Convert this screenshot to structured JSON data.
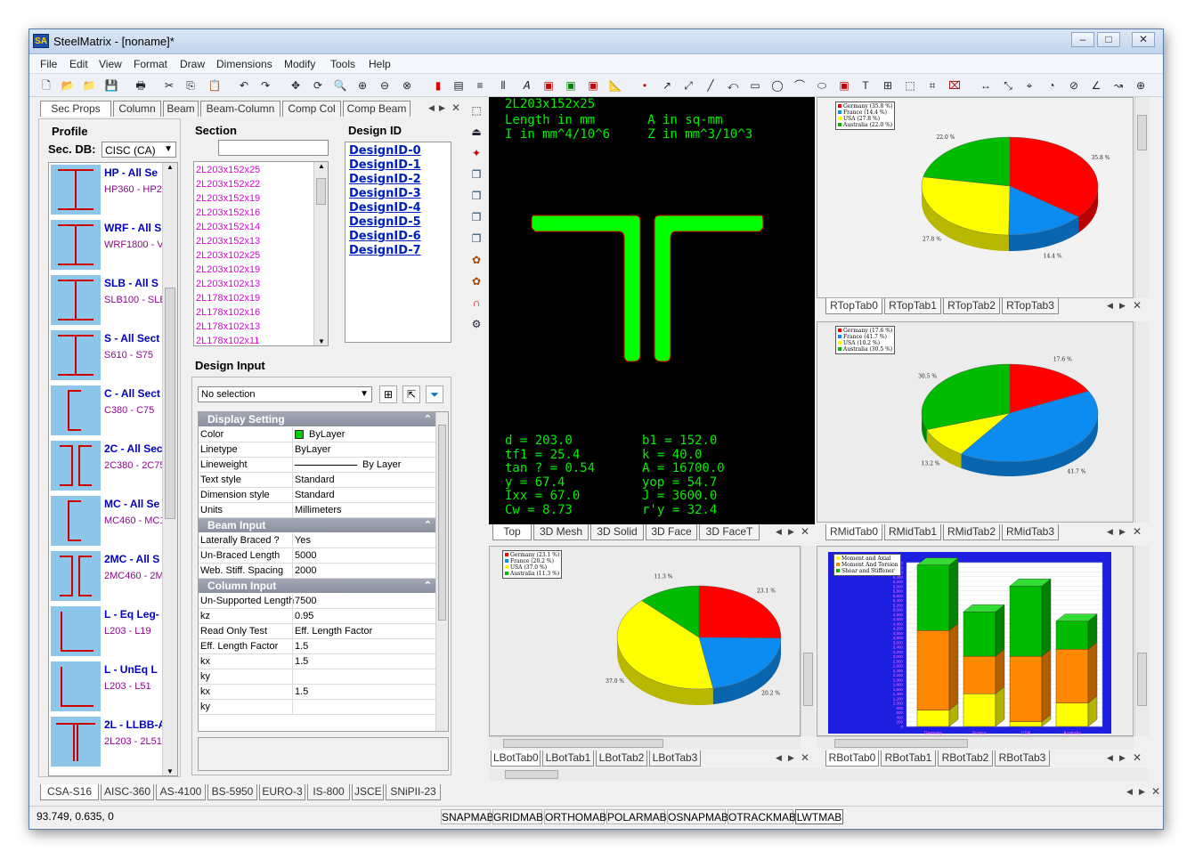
{
  "window": {
    "title": "SteelMatrix - [noname]*",
    "app_icon": "SA"
  },
  "menu": [
    "File",
    "Edit",
    "View",
    "Format",
    "Draw",
    "Dimensions",
    "Modify",
    "Tools",
    "Help"
  ],
  "left_tabs": [
    "Sec Props",
    "Column",
    "Beam",
    "Beam-Column",
    "Comp Col",
    "Comp Beam"
  ],
  "profile": {
    "title": "Profile",
    "sec_db_label": "Sec. DB:",
    "sec_db_value": "CISC (CA)",
    "items": [
      {
        "name": "HP - All Se",
        "range": "HP360 - HP2",
        "icon": "wide-flange-icon"
      },
      {
        "name": "WRF - All S",
        "range": "WRF1800 - V",
        "icon": "wide-flange-icon"
      },
      {
        "name": "SLB - All S",
        "range": "SLB100 - SLB",
        "icon": "wide-flange-icon"
      },
      {
        "name": "S - All Sect",
        "range": "S610 - S75",
        "icon": "wide-flange-icon"
      },
      {
        "name": "C - All Sect",
        "range": "C380 - C75",
        "icon": "channel-icon"
      },
      {
        "name": "2C - All Sec",
        "range": "2C380 - 2C75",
        "icon": "double-channel-icon"
      },
      {
        "name": "MC - All Se",
        "range": "MC460 - MC1",
        "icon": "channel-icon"
      },
      {
        "name": "2MC - All S",
        "range": "2MC460 - 2M",
        "icon": "double-channel-icon"
      },
      {
        "name": "L - Eq Leg-",
        "range": "L203 - L19",
        "icon": "angle-icon"
      },
      {
        "name": "L - UnEq L",
        "range": "L203 - L51",
        "icon": "angle-icon"
      },
      {
        "name": "2L - LLBB-A",
        "range": "2L203 - 2L51",
        "icon": "double-angle-icon"
      }
    ]
  },
  "section": {
    "title": "Section",
    "search_value": "",
    "items": [
      "2L203x152x25",
      "2L203x152x22",
      "2L203x152x19",
      "2L203x152x16",
      "2L203x152x14",
      "2L203x152x13",
      "2L203x102x25",
      "2L203x102x19",
      "2L203x102x13",
      "2L178x102x19",
      "2L178x102x16",
      "2L178x102x13",
      "2L178x102x11"
    ]
  },
  "design_id": {
    "title": "Design ID",
    "items": [
      "DesignID-0",
      "DesignID-1",
      "DesignID-2",
      "DesignID-3",
      "DesignID-4",
      "DesignID-5",
      "DesignID-6",
      "DesignID-7"
    ]
  },
  "design_input": {
    "title": "Design Input",
    "selection": "No selection",
    "groups": [
      {
        "title": "Display Setting",
        "rows": [
          {
            "k": "Color",
            "v": "ByLayer",
            "swatch": "#00cc00"
          },
          {
            "k": "Linetype",
            "v": "ByLayer"
          },
          {
            "k": "Lineweight",
            "v": "By Layer",
            "line": true
          },
          {
            "k": "Text style",
            "v": "Standard"
          },
          {
            "k": "Dimension style",
            "v": "Standard"
          },
          {
            "k": "Units",
            "v": "Millimeters"
          }
        ]
      },
      {
        "title": "Beam Input",
        "rows": [
          {
            "k": "Laterally Braced ?",
            "v": "Yes"
          },
          {
            "k": "Un-Braced Length",
            "v": "5000"
          },
          {
            "k": "Web. Stiff. Spacing",
            "v": "2000"
          }
        ]
      },
      {
        "title": "Column Input",
        "rows": [
          {
            "k": "Un-Supported Length",
            "v": "7500"
          },
          {
            "k": "kz",
            "v": "0.95"
          },
          {
            "k": "Read Only Test",
            "v": "Eff. Length Factor"
          },
          {
            "k": "Eff. Length Factor",
            "v": "1.5"
          },
          {
            "k": "kx",
            "v": "1.5"
          },
          {
            "k": "ky",
            "v": ""
          },
          {
            "k": "kx",
            "v": "1.5"
          },
          {
            "k": "ky",
            "v": ""
          }
        ]
      }
    ]
  },
  "viewer": {
    "name": "2L203x152x25",
    "units_line1": "Length in mm       A in sq-mm",
    "units_line2": "I in mm^4/10^6     Z in mm^3/10^3",
    "props": [
      [
        "d = 203.0",
        "b1 = 152.0"
      ],
      [
        "tf1 = 25.4",
        "k = 40.0"
      ],
      [
        "tan ? = 0.54",
        "A = 16700.0"
      ],
      [
        "y = 67.4",
        "yop = 54.7"
      ],
      [
        "Ixx = 67.0",
        "J = 3600.0"
      ],
      [
        "Cw = 8.73",
        "r'y = 32.4"
      ]
    ],
    "tabs": [
      "Top",
      "3D Mesh",
      "3D Solid",
      "3D Face",
      "3D FaceT"
    ]
  },
  "right_top": {
    "tabs": [
      "RTopTab0",
      "RTopTab1",
      "RTopTab2",
      "RTopTab3"
    ],
    "legend": [
      "Germany (35.8 %)",
      "France (14.4 %)",
      "USA (27.8 %)",
      "Australia (22.0 %)"
    ],
    "labels": [
      "22.0 %",
      "35.8 %",
      "27.8 %",
      "14.4 %"
    ]
  },
  "right_mid": {
    "tabs": [
      "RMidTab0",
      "RMidTab1",
      "RMidTab2",
      "RMidTab3"
    ],
    "legend": [
      "Germany (17.6 %)",
      "France (41.7 %)",
      "USA (10.2 %)",
      "Australia (30.5 %)"
    ],
    "labels": [
      "30.5 %",
      "17.6 %",
      "13.2 %",
      "41.7 %"
    ]
  },
  "left_bottom": {
    "tabs": [
      "LBotTab0",
      "LBotTab1",
      "LBotTab2",
      "LBotTab3"
    ],
    "legend": [
      "Germany (23.1 %)",
      "France (20.2 %)",
      "USA (37.0 %)",
      "Australia (11.3 %)"
    ],
    "labels": [
      "11.3 %",
      "23.1 %",
      "37.0 %",
      "20.2 %"
    ]
  },
  "right_bottom": {
    "tabs": [
      "RBotTab0",
      "RBotTab1",
      "RBotTab2",
      "RBotTab3"
    ],
    "legend": [
      "Moment and Axial",
      "Moment And Torsion",
      "Shear and Stiffener"
    ],
    "categories": [
      "Germany",
      "France",
      "USA",
      "Australia"
    ],
    "yticks": [
      "7,000",
      "6,800",
      "6,600",
      "6,400",
      "6,200",
      "6,000",
      "5,800",
      "5,600",
      "5,400",
      "5,200",
      "5,000",
      "4,800",
      "4,600",
      "4,400",
      "4,200",
      "4,000",
      "3,800",
      "3,600",
      "3,400",
      "3,200",
      "3,000",
      "2,800",
      "2,600",
      "2,400",
      "2,200",
      "2,000",
      "1,800",
      "1,600",
      "1,400",
      "1,200",
      "1,000",
      "800",
      "600",
      "400",
      "200",
      "0"
    ]
  },
  "code_tabs": [
    "CSA-S16",
    "AISC-360",
    "AS-4100",
    "BS-5950",
    "EURO-3",
    "IS-800",
    "JSCE",
    "SNiPII-23"
  ],
  "status": {
    "coords": "93.749, 0.635, 0",
    "buttons": [
      "SNAPMAB",
      "GRIDMAB",
      "ORTHOMAB",
      "POLARMAB",
      "OSNAPMAB",
      "OTRACKMAB",
      "LWTMAB"
    ]
  },
  "colors": {
    "germany": "#ff0000",
    "france": "#0c8cf0",
    "usa": "#ffff00",
    "australia": "#00bb00",
    "section_fill": "#00ff00",
    "viewer_bg": "#000000"
  },
  "chart_data": [
    {
      "type": "pie",
      "title": "",
      "categories": [
        "Germany",
        "France",
        "USA",
        "Australia"
      ],
      "values": [
        35.8,
        14.4,
        27.8,
        22.0
      ]
    },
    {
      "type": "pie",
      "title": "",
      "categories": [
        "Germany",
        "France",
        "USA",
        "Australia"
      ],
      "values": [
        17.6,
        41.7,
        10.2,
        30.5
      ]
    },
    {
      "type": "pie",
      "title": "",
      "categories": [
        "Germany",
        "France",
        "USA",
        "Australia"
      ],
      "values": [
        23.1,
        20.2,
        37.0,
        11.3
      ]
    },
    {
      "type": "bar",
      "title": "",
      "stacked": true,
      "categories": [
        "Germany",
        "France",
        "USA",
        "Australia"
      ],
      "series": [
        {
          "name": "Moment and Axial",
          "values": [
            700,
            1400,
            200,
            1000
          ]
        },
        {
          "name": "Moment And Torsion",
          "values": [
            3400,
            1600,
            2800,
            2300
          ]
        },
        {
          "name": "Shear and Stiffener",
          "values": [
            2800,
            1900,
            3000,
            1200
          ]
        }
      ],
      "ylim": [
        0,
        7000
      ]
    }
  ]
}
